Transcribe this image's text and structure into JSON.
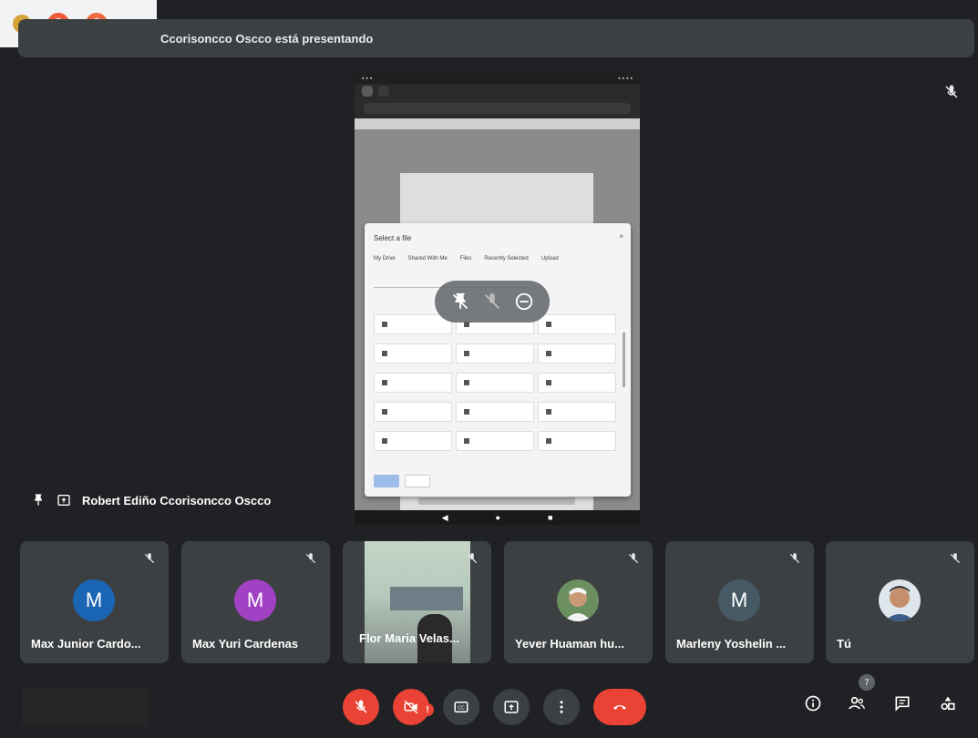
{
  "extensions": [
    {
      "icon": "extension-badge-icon",
      "color": "#d4a43a"
    },
    {
      "icon": "extension-a-icon",
      "color": "#ef5b3a"
    },
    {
      "icon": "extension-b-icon",
      "color": "#ef6a3f"
    }
  ],
  "banner": {
    "text": "Ccorisoncco Oscco está presentando"
  },
  "shared_screen": {
    "dialog_title": "Select a file",
    "dialog_tabs": [
      "My Drive",
      "Shared With Me",
      "Files",
      "Recently Selected",
      "Upload"
    ],
    "folders": [
      "",
      "",
      "",
      "",
      "",
      "",
      "",
      "",
      "",
      "",
      "",
      "",
      "",
      "",
      "",
      "",
      "",
      ""
    ]
  },
  "presenter": {
    "name": "Robert Ediño Ccorisoncco Oscco"
  },
  "participants": [
    {
      "name": "Max Junior Cardo...",
      "initial": "M",
      "avatar_color": "#1a66b5",
      "type": "avatar"
    },
    {
      "name": "Max Yuri Cardenas",
      "initial": "M",
      "avatar_color": "#a142c4",
      "type": "avatar"
    },
    {
      "name": "Flor Maria Velas...",
      "type": "video"
    },
    {
      "name": "Yever Huaman hu...",
      "type": "photo"
    },
    {
      "name": "Marleny Yoshelin ...",
      "initial": "M",
      "avatar_color": "#455a64",
      "type": "avatar"
    },
    {
      "name": "Tú",
      "type": "photo"
    }
  ],
  "controls": {
    "warning_badge": "!",
    "participants_count": "7",
    "mic": "muted",
    "camera": "off"
  },
  "colors": {
    "background": "#202124",
    "tile": "#3c4043",
    "danger": "#ea4335"
  }
}
